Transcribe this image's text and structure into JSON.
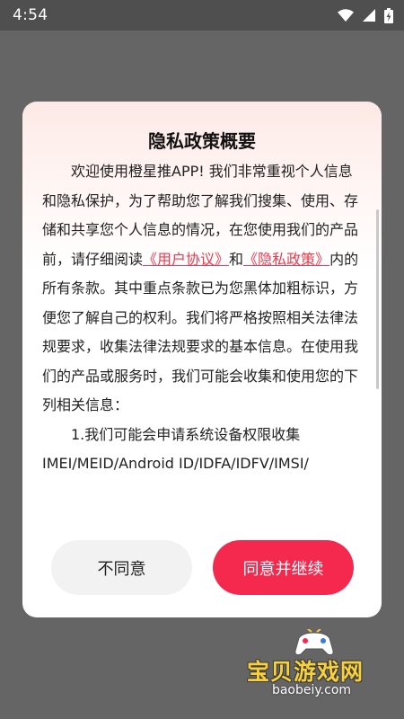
{
  "status_bar": {
    "time": "4:54",
    "icons": [
      "wifi-icon",
      "signal-icon",
      "battery-charging-icon"
    ]
  },
  "dialog": {
    "title": "隐私政策概要",
    "paragraph1": {
      "intro": "欢迎使用橙星推APP! 我们非常重视个人信息和隐私保护，为了帮助您了解我们搜集、使用、存储和共享您个人信息的情况，在您使用我们的产品前，请仔细阅读",
      "user_agreement_link": "《用户协议》",
      "and": "和",
      "privacy_policy_link": "《隐私政策》",
      "rest": "内的所有条款。其中重点条款已为您黑体加粗标识，方便您了解自己的权利。我们将严格按照相关法律法规要求，收集法律法规要求的基本信息。在使用我们的产品或服务时，我们可能会收集和使用您的下列相关信息："
    },
    "paragraph2": "1.我们可能会申请系统设备权限收集IMEI/MEID/Android ID/IDFA/IDFV/IMSI/",
    "disagree_label": "不同意",
    "agree_label": "同意并继续"
  },
  "watermark": {
    "text": "宝贝游戏网",
    "url": "baobeiy.com"
  },
  "colors": {
    "accent": "#f5294e",
    "link": "#ea3b4f",
    "overlay": "#656565"
  }
}
